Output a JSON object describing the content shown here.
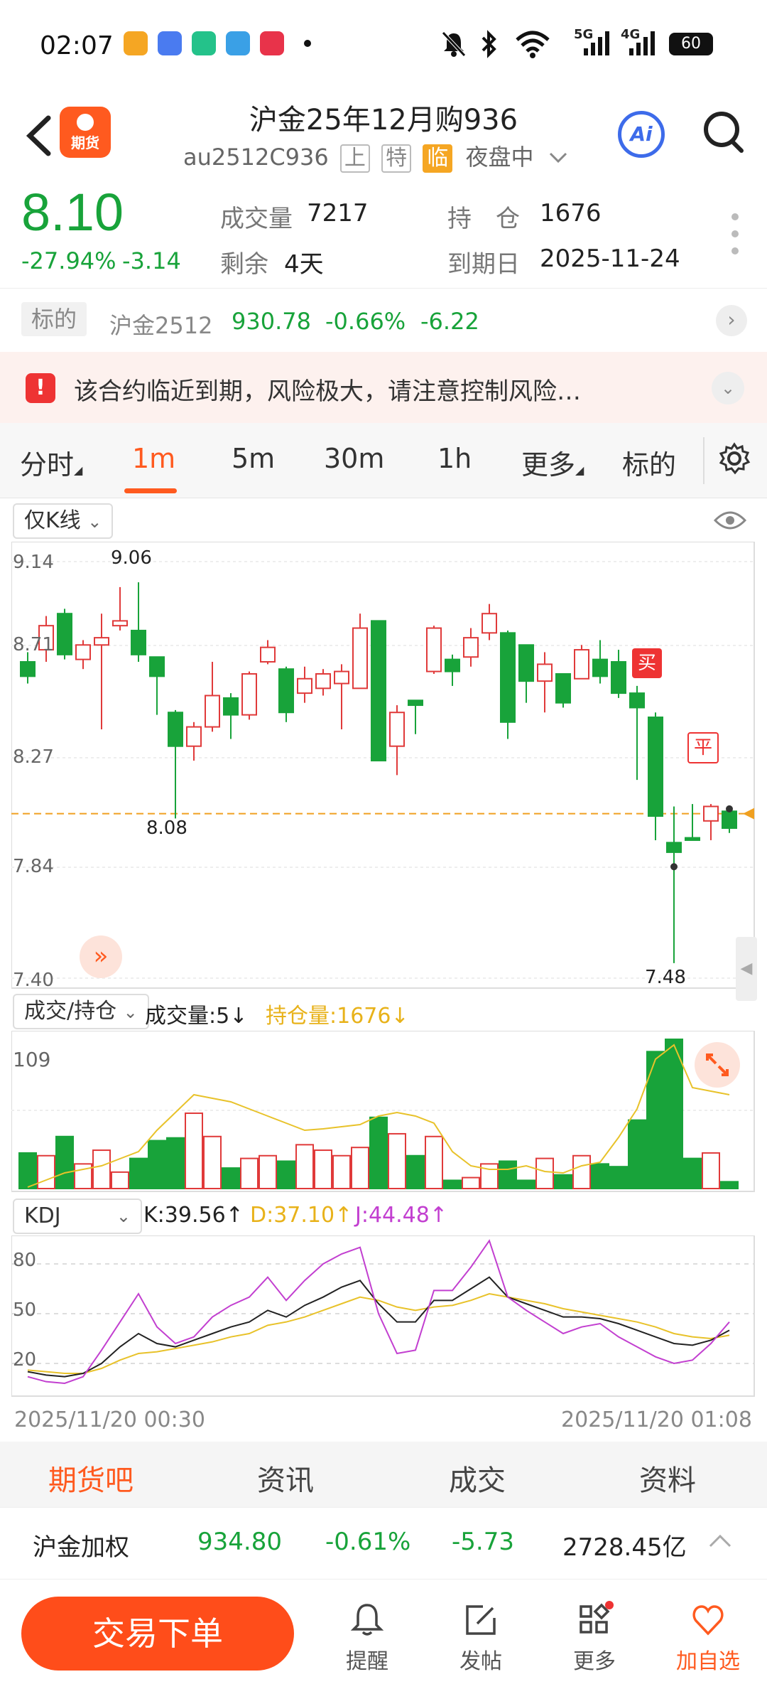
{
  "status_bar": {
    "time": "02:07",
    "battery": "60",
    "signal_5g": "5G",
    "signal_4g": "4G"
  },
  "header": {
    "title": "沪金25年12月购936",
    "code": "au2512C936",
    "tags": [
      "上",
      "特",
      "临"
    ],
    "session": "夜盘中",
    "logo_text": "期货",
    "ai_label": "Ai"
  },
  "quote": {
    "price": "8.10",
    "change_pct": "-27.94%",
    "change": "-3.14",
    "volume_label": "成交量",
    "volume": "7217",
    "oi_label": "持　仓",
    "oi": "1676",
    "remaining_label": "剩余",
    "remaining": "4天",
    "expiry_label": "到期日",
    "expiry": "2025-11-24"
  },
  "underlying": {
    "label": "标的",
    "name": "沪金2512",
    "price": "930.78",
    "pct": "-0.66%",
    "chg": "-6.22"
  },
  "warning": {
    "text": "该合约临近到期，风险极大，请注意控制风险…"
  },
  "tabs": [
    {
      "label": "分时",
      "active": false
    },
    {
      "label": "1m",
      "active": true
    },
    {
      "label": "5m",
      "active": false
    },
    {
      "label": "30m",
      "active": false
    },
    {
      "label": "1h",
      "active": false
    },
    {
      "label": "更多",
      "active": false
    },
    {
      "label": "标的",
      "active": false
    }
  ],
  "kline": {
    "selector": "仅K线",
    "y_labels": [
      "9.14",
      "8.71",
      "8.27",
      "7.84",
      "7.40"
    ],
    "max_label": "9.06",
    "low_label": "8.08",
    "min_label": "7.48",
    "buy_marker": "买",
    "close_marker": "平"
  },
  "volume_panel": {
    "selector": "成交/持仓",
    "vol_text": "成交量:5",
    "oi_text": "持仓量:1676",
    "max_label": "109"
  },
  "kdj_panel": {
    "selector": "KDJ",
    "k_text": "K:39.56",
    "d_text": "D:37.10",
    "j_text": "J:44.48",
    "y_labels": [
      "80",
      "50",
      "20"
    ]
  },
  "time_axis": {
    "start": "2025/11/20 00:30",
    "end": "2025/11/20 01:08"
  },
  "bottom_tabs": [
    {
      "label": "期货吧",
      "active": true
    },
    {
      "label": "资讯",
      "active": false
    },
    {
      "label": "成交",
      "active": false
    },
    {
      "label": "资料",
      "active": false
    }
  ],
  "index_row": {
    "name": "沪金加权",
    "price": "934.80",
    "pct": "-0.61%",
    "chg": "-5.73",
    "amount": "2728.45亿"
  },
  "bottom_bar": {
    "trade_button": "交易下单",
    "nav": [
      {
        "label": "提醒",
        "icon": "bell-icon"
      },
      {
        "label": "发帖",
        "icon": "compose-icon"
      },
      {
        "label": "更多",
        "icon": "grid-icon"
      },
      {
        "label": "加自选",
        "icon": "heart-icon"
      }
    ]
  },
  "colors": {
    "up": "#e03a3a",
    "down": "#18a33a",
    "accent": "#ff5a1f",
    "k_line": "#222222",
    "d_line": "#e8c22a",
    "j_line": "#c23fd0"
  }
}
